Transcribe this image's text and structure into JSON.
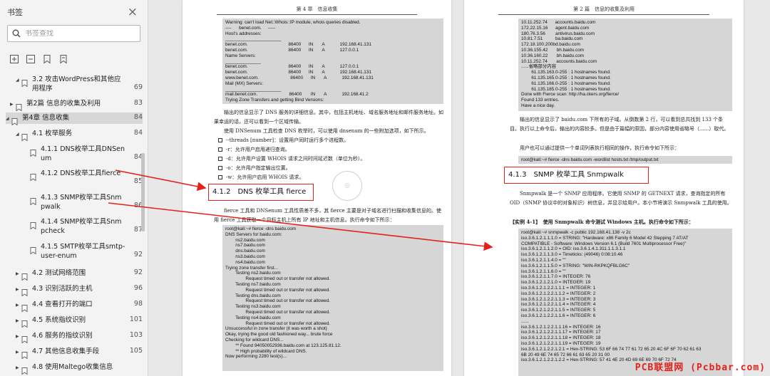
{
  "sidebar": {
    "title": "书签",
    "search_placeholder": "书签查找",
    "toc": [
      {
        "label": "3.2 攻击WordPress和其他应用程序",
        "page": "69",
        "expanded": true
      },
      {
        "label": "第2篇 信息的收集及利用",
        "page": "83",
        "expanded": false
      },
      {
        "label": "第4章 信息收集",
        "page": "84",
        "expanded": true
      },
      {
        "label": "4.1 枚举服务",
        "page": "84",
        "expanded": true
      },
      {
        "label": "4.1.1 DNS枚举工具DNSenum",
        "page": "84"
      },
      {
        "label": "4.1.2 DNS枚举工具fierce",
        "page": "85"
      },
      {
        "label": "4.1.3 SNMP枚举工具Snmpwalk",
        "page": "86"
      },
      {
        "label": "4.1.4 SNMP枚举工具Snmpcheck",
        "page": "87"
      },
      {
        "label": "4.1.5 SMTP枚举工具smtp-user-enum",
        "page": "92"
      },
      {
        "label": "4.2 测试网络范围",
        "page": "92",
        "expanded": false
      },
      {
        "label": "4.3 识别活跃的主机",
        "page": "96",
        "expanded": false
      },
      {
        "label": "4.4 查看打开的端口",
        "page": "98",
        "expanded": false
      },
      {
        "label": "4.5 系统指纹识别",
        "page": "101",
        "expanded": false
      },
      {
        "label": "4.6 服务的指纹识别",
        "page": "103",
        "expanded": false
      },
      {
        "label": "4.7 其他信息收集手段",
        "page": "105",
        "expanded": false
      },
      {
        "label": "4.8 使用Maltego收集信息",
        "page": "",
        "expanded": false
      }
    ]
  },
  "left_page": {
    "header": "第 4 章　信息收集",
    "code1": "Warning: can't load Net::Whois::IP module, whois queries disabled.\n----      benet.com.     -----\nHost's addresses:\n______________________\nbenet.com.                                86400      IN       A            192.168.41.131\nbenet.com.                                86400      IN       A            127.0.0.1\nName Servers:\n______________\nbenet.com.                                86400      IN       A            127.0.0.1\nbenet.com.                                86400      IN       A            192.168.41.131\nwww.benet.com.                         86400      IN       A            192.168.41.131\nMail (MX) Servers:\n______________________\nmail.benet.com.                         86400       IN       A            192.168.41.2\nTrying Zone Transfers and getting Bind Versions:",
    "para1": "输出的信息显示了 DNS 服务的详细信息。其中，包括主机地址、域名服务地址和邮件服务地址。如果幸运的话，还可以看到一个区域传输。",
    "para2": "使用 DNSenum 工具检查 DNS 枚举时，可以使用 dnsenum 的一些附加选项，如下所示。",
    "bullets": [
      "--threads [number]：设置用户同时运行多个进程数。",
      "-r：允许用户启用递归查询。",
      "-d：允许用户设置 WHOIS 请求之间时间延迟数（单位为秒）。",
      "-o：允许用户指定输出位置。",
      "-w：允许用户启用 WHOIS 请求。"
    ],
    "heading": "4.1.2　DNS 枚举工具 fierce",
    "para3": "fierce 工具和 DNSenum 工具性质差不多，其 fierce 主要是对子域名进行扫描和收集信息的。使用 fierce 工具获取一个目标主机上所有 IP 地址和主机信息。执行命令如下所示：",
    "code2": "root@kali:~# fierce -dns baidu.com\nDNS Servers for baidu.com:\n        ns2.baidu.com\n        ns7.baidu.com\n        dns.baidu.com\n        ns3.baidu.com\n        ns4.baidu.com\nTrying zone transfer first...\n        Testing ns2.baidu.com\n                Request timed out or transfer not allowed.\n        Testing ns7.baidu.com\n                Request timed out or transfer not allowed.\n        Testing dns.baidu.com\n                Request timed out or transfer not allowed.\n        Testing ns3.baidu.com\n                Request timed out or transfer not allowed.\n        Testing ns4.baidu.com\n                Request timed out or transfer not allowed.\nUnsuccessful in zone transfer (it was worth a shot)\nOkay, trying the good old fashioned way... brute force\nChecking for wildcard DNS...\n        ** Found 94050052936.baidu.com at 123.125.81.12.\n        ** High probability of wildcard DNS.\nNow performing 2280 test(s)..."
  },
  "right_page": {
    "header": "第 2 篇　信息的收集及利用",
    "code1": "10.11.252.74      accounts.baidu.com\n172.22.15.16      agent.baidu.com\n180.76.3.56        antivirus.baidu.com\n10.81.7.51          ba.baidu.com\n172.18.100.200bd.baidu.com\n10.36.155.42       bh.baidu.com\n10.36.160.22       bh.baidu.com\n10.11.252.74       accounts.baidu.com\n......省略部分内容\n        61.135.163.0-255 : 1 hostnames found.\n        61.135.165.0-255 : 1 hostnames found.\n        61.135.166.0-255 : 1 hostnames found.\n        61.135.185.0-255 : 1 hostnames found.\nDone with Fierce scan: http://ha.ckers.org/fierce/\nFound 133 entries.\nHave a nice day.",
    "para1": "输出的信息显示了 baidu.com 下所有的子域。从倒数第 2 行，可以看到总共找到 133 个条目。执行以上命令后，输出的内容较多。但是由于篇幅的原因，部分内容使用省略号（......）取代。",
    "para2": "用户也可以通过提供一个单词列表执行相同的操作，执行命令如下所示：",
    "code_cmd": "root@kali:~# fierce -dns baidu.com -wordlist hosts.txt /tmp/output.txt",
    "heading": "4.1.3　SNMP 枚举工具 Snmpwalk",
    "para3": "Snmpwalk 是一个 SNMP 应用程序。它使用 SNMP 的 GETNEXT 请求，查询指定的所有 OID（SNMP 协议中的对象标识）树信息，并显示给用户。本小节将演示 Snmpwalk 工具的使用。",
    "example": "【实例 4-1】　使用 Snmpwalk 命令测试 Windows 主机。执行命令如下所示：",
    "code2": "root@kali:~# snmpwalk -c public 192.168.41.138 -v 2c\niso.3.6.1.2.1.1.1.0 = STRING: \"Hardware: x86 Family 6 Model 42 Stepping 7 AT/AT\nCOMPATIBLE - Software: Windows Version 6.1 (Build 7601 Multiprocessor Free)\"\niso.3.6.1.2.1.1.2.0 = OID: iso.3.6.1.4.1.311.1.1.3.1.1\niso.3.6.1.2.1.1.3.0 = Timeticks: (49046) 0:08:10.46\niso.3.6.1.2.1.1.4.0 = \"\"\niso.3.6.1.2.1.1.5.0 = STRING: \"WIN-RKPKQFBLG6C\"\niso.3.6.1.2.1.1.6.0 = \"\"\niso.3.6.1.2.1.1.7.0 = INTEGER: 76\niso.3.6.1.2.1.2.1.0 = INTEGER: 19\niso.3.6.1.2.1.2.2.1.1.1 = INTEGER: 1\niso.3.6.1.2.1.2.2.1.1.2 = INTEGER: 2\niso.3.6.1.2.1.2.2.1.1.3 = INTEGER: 3\niso.3.6.1.2.1.2.2.1.1.4 = INTEGER: 4\niso.3.6.1.2.1.2.2.1.1.5 = INTEGER: 5\niso.3.6.1.2.1.2.2.1.1.6 = INTEGER: 6\n......\niso.3.6.1.2.1.2.2.1.1.16 = INTEGER: 16\niso.3.6.1.2.1.2.2.1.1.17 = INTEGER: 17\niso.3.6.1.2.1.2.2.1.1.18 = INTEGER: 18\niso.3.6.1.2.1.2.2.1.1.19 = INTEGER: 19\niso.3.6.1.2.1.2.2.1.2.1 = Hex-STRING: 53 6F 66 74 77 61 72 65 20 4C 6F 6F 70 62 61 63\n6B 20 49 6E 74 65 72 66 61 63 65 20 31 00\niso.3.6.1.2.1.2.2.1.2.2 = Hex-STRING: 57 41 4E 20 4D 69 6E 69 70 6F 72 74"
  },
  "watermark": "PCB联盟网 (Pcbbar.com)",
  "colors": {
    "annotation": "#e3221c",
    "code_bg": "#d6d6d6",
    "selected_row": "#d7d7d7"
  }
}
